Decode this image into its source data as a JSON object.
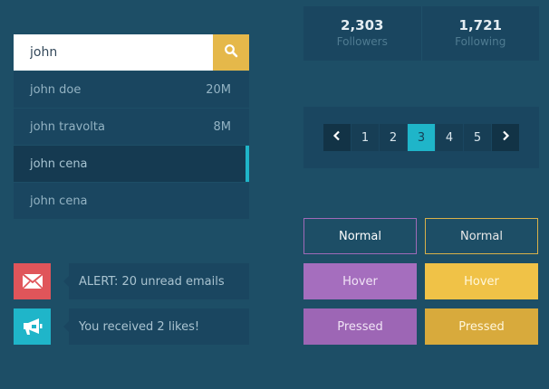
{
  "search": {
    "value": "john",
    "results": [
      {
        "name": "john doe",
        "count": "20M"
      },
      {
        "name": "john travolta",
        "count": "8M"
      },
      {
        "name": "john cena",
        "count": ""
      },
      {
        "name": "john cena",
        "count": ""
      }
    ]
  },
  "notifications": [
    {
      "icon": "envelope-icon",
      "color": "#e0555a",
      "text": "ALERT: 20 unread emails"
    },
    {
      "icon": "megaphone-icon",
      "color": "#1fb5c9",
      "text": "You received 2 likes!"
    }
  ],
  "stats": [
    {
      "number": "2,303",
      "label": "Followers"
    },
    {
      "number": "1,721",
      "label": "Following"
    }
  ],
  "pagination": {
    "pages": [
      "1",
      "2",
      "3",
      "4",
      "5"
    ],
    "current": "3"
  },
  "buttons": {
    "normal_purple": "Normal",
    "normal_yellow": "Normal",
    "hover_purple": "Hover",
    "hover_yellow": "Hover",
    "pressed_purple": "Pressed",
    "pressed_yellow": "Pressed"
  },
  "colors": {
    "background": "#1d4e66",
    "panel": "#1a4660",
    "accent_cyan": "#1fb5c9",
    "accent_yellow": "#e5b84a",
    "accent_purple": "#a56ebe",
    "alert_red": "#e0555a"
  }
}
